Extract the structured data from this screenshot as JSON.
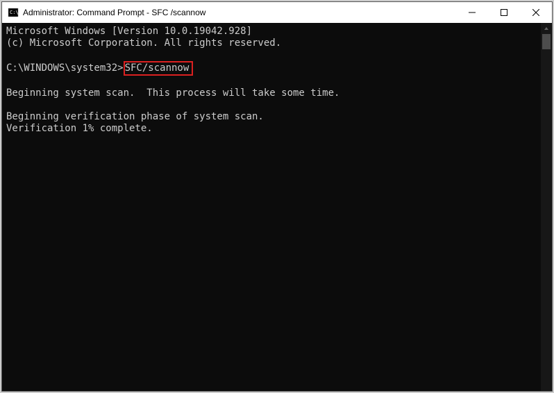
{
  "titlebar": {
    "title": "Administrator: Command Prompt - SFC /scannow"
  },
  "terminal": {
    "line1": "Microsoft Windows [Version 10.0.19042.928]",
    "line2": "(c) Microsoft Corporation. All rights reserved.",
    "prompt": "C:\\WINDOWS\\system32>",
    "command": "SFC/scannow",
    "scan_msg": "Beginning system scan.  This process will take some time.",
    "verify_msg": "Beginning verification phase of system scan.",
    "progress_msg": "Verification 1% complete."
  }
}
